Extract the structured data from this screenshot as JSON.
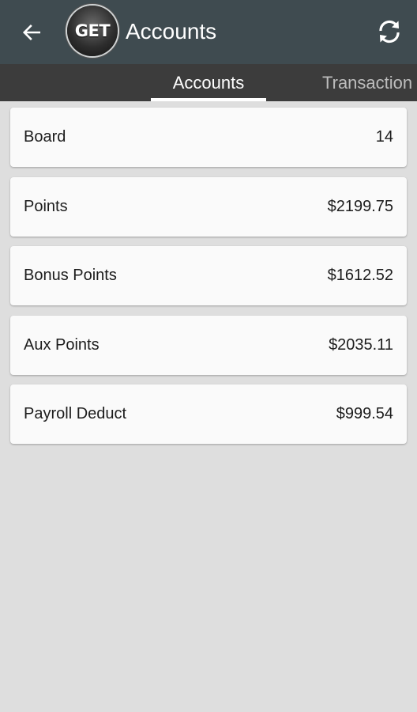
{
  "app_bar": {
    "logo_text": "GET",
    "title": "Accounts",
    "background": "#3f4b50",
    "back_icon": "arrow-left-icon",
    "refresh_icon": "refresh-icon"
  },
  "tabs": [
    {
      "label": "Accounts",
      "selected": true
    },
    {
      "label": "Transaction",
      "selected": false
    }
  ],
  "accounts": [
    {
      "label": "Board",
      "value": "14"
    },
    {
      "label": "Points",
      "value": "$2199.75"
    },
    {
      "label": "Bonus Points",
      "value": "$1612.52"
    },
    {
      "label": "Aux Points",
      "value": "$2035.11"
    },
    {
      "label": "Payroll Deduct",
      "value": "$999.54"
    }
  ]
}
